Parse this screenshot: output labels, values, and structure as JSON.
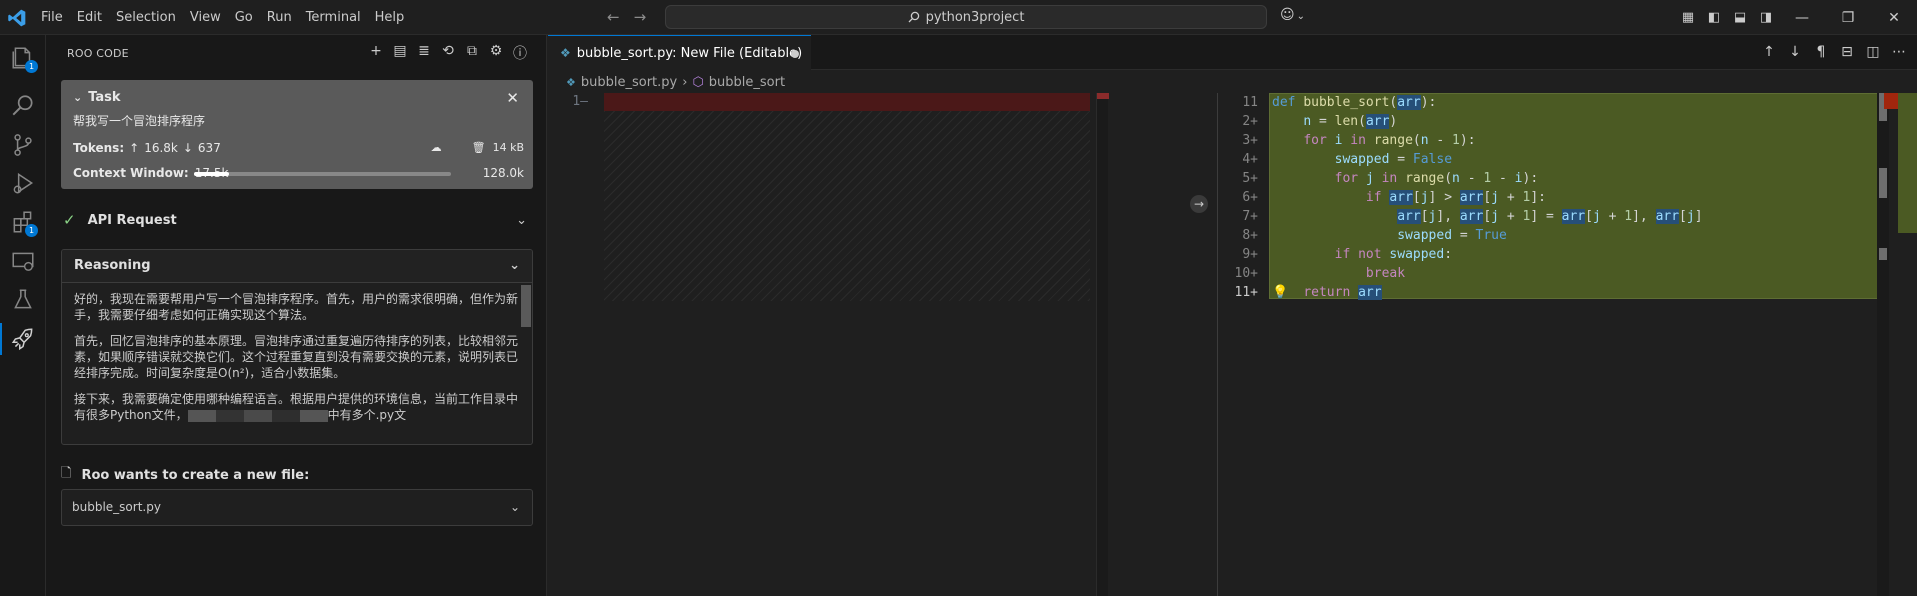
{
  "titlebar": {
    "menu": [
      "File",
      "Edit",
      "Selection",
      "View",
      "Go",
      "Run",
      "Terminal",
      "Help"
    ],
    "search_text": "python3project"
  },
  "activity": {
    "explorer_badge": "1",
    "extensions_badge": "1"
  },
  "sidebar": {
    "title": "ROO CODE",
    "task": {
      "header": "Task",
      "prompt": "帮我写一个冒泡排序程序",
      "tokens_label": "Tokens:",
      "tokens_in": "16.8k",
      "tokens_out": "637",
      "size": "14 kB",
      "context_label": "Context Window:",
      "context_used": "17.5k",
      "context_max": "128.0k",
      "context_fraction": 0.137
    },
    "api_request": "API Request",
    "reasoning": {
      "header": "Reasoning",
      "p1": "好的，我现在需要帮用户写一个冒泡排序程序。首先，用户的需求很明确，但作为新手，我需要仔细考虑如何正确实现这个算法。",
      "p2": "首先，回忆冒泡排序的基本原理。冒泡排序通过重复遍历待排序的列表，比较相邻元素，如果顺序错误就交换它们。这个过程重复直到没有需要交换的元素，说明列表已经排序完成。时间复杂度是O(n²)，适合小数据集。",
      "p3a": "接下来，我需要确定使用哪种编程语言。根据用户提供的环境信息，当前工作目录中有很多Python文件，",
      "p3b": "中有多个.py文"
    },
    "create_label": "Roo wants to create a new file:",
    "file_name": "bubble_sort.py"
  },
  "editor": {
    "tab_label": "bubble_sort.py: New File (Editable)",
    "breadcrumb_file": "bubble_sort.py",
    "breadcrumb_symbol": "bubble_sort",
    "left_line": "1",
    "code_lines": [
      {
        "n": "11",
        "text": "def bubble_sort(arr):"
      },
      {
        "n": "2+",
        "text": "    n = len(arr)"
      },
      {
        "n": "3+",
        "text": "    for i in range(n - 1):"
      },
      {
        "n": "4+",
        "text": "        swapped = False"
      },
      {
        "n": "5+",
        "text": "        for j in range(n - 1 - i):"
      },
      {
        "n": "6+",
        "text": "            if arr[j] > arr[j + 1]:"
      },
      {
        "n": "7+",
        "text": "                arr[j], arr[j + 1] = arr[j + 1], arr[j]"
      },
      {
        "n": "8+",
        "text": "                swapped = True"
      },
      {
        "n": "9+",
        "text": "        if not swapped:"
      },
      {
        "n": "10+",
        "text": "            break"
      },
      {
        "n": "11+",
        "text": "    return arr"
      }
    ]
  }
}
